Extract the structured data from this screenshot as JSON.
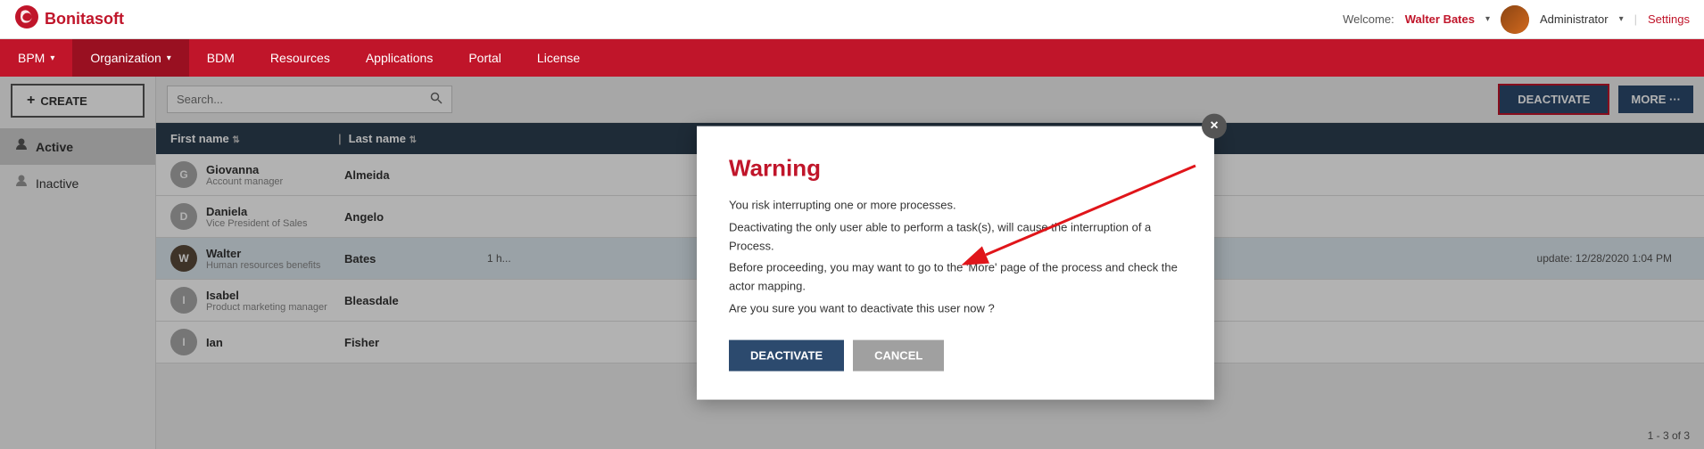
{
  "app": {
    "logo_icon": "G",
    "logo_name": "Bonitasoft"
  },
  "topbar": {
    "welcome_label": "Welcome:",
    "user_name": "Walter Bates",
    "admin_label": "Administrator",
    "settings_label": "Settings"
  },
  "navbar": {
    "items": [
      {
        "label": "BPM",
        "has_arrow": true
      },
      {
        "label": "Organization",
        "has_arrow": true
      },
      {
        "label": "BDM",
        "has_arrow": false
      },
      {
        "label": "Resources",
        "has_arrow": false
      },
      {
        "label": "Applications",
        "has_arrow": false
      },
      {
        "label": "Portal",
        "has_arrow": false
      },
      {
        "label": "License",
        "has_arrow": false
      }
    ]
  },
  "sidebar": {
    "create_label": "CREATE",
    "items": [
      {
        "label": "Active",
        "icon": "person"
      },
      {
        "label": "Inactive",
        "icon": "person"
      }
    ]
  },
  "toolbar": {
    "search_placeholder": "Search...",
    "deactivate_label": "DEACTIVATE",
    "more_label": "MORE ···"
  },
  "table": {
    "columns": [
      {
        "label": "First name"
      },
      {
        "label": "Last name"
      }
    ],
    "rows": [
      {
        "first": "Giovanna",
        "last": "Almeida",
        "sub": "Account manager",
        "extra": "",
        "detail": ""
      },
      {
        "first": "Daniela",
        "last": "Angelo",
        "sub": "Vice President of Sales",
        "extra": "",
        "detail": ""
      },
      {
        "first": "Walter",
        "last": "Bates",
        "sub": "Human resources benefits",
        "extra": "1 h...",
        "detail": "update: 12/28/2020 1:04 PM"
      },
      {
        "first": "Isabel",
        "last": "Bleasdale",
        "sub": "Product marketing manager",
        "extra": "",
        "detail": ""
      },
      {
        "first": "Ian",
        "last": "Fisher",
        "sub": "",
        "extra": "",
        "detail": ""
      }
    ],
    "pagination": "1 - 3 of 3"
  },
  "modal": {
    "title": "Warning",
    "line1": "You risk interrupting one or more processes.",
    "line2": "Deactivating the only user able to perform a task(s), will cause the interruption of a Process.",
    "line3": "Before proceeding, you may want to go to the 'More' page of the process and check the actor mapping.",
    "line4": "Are you sure you want to deactivate this user now ?",
    "deactivate_label": "DEACTIVATE",
    "cancel_label": "CANCEL"
  },
  "colors": {
    "brand_red": "#c0152a",
    "nav_dark": "#2c4a6e",
    "header_dark": "#2c3e50"
  }
}
